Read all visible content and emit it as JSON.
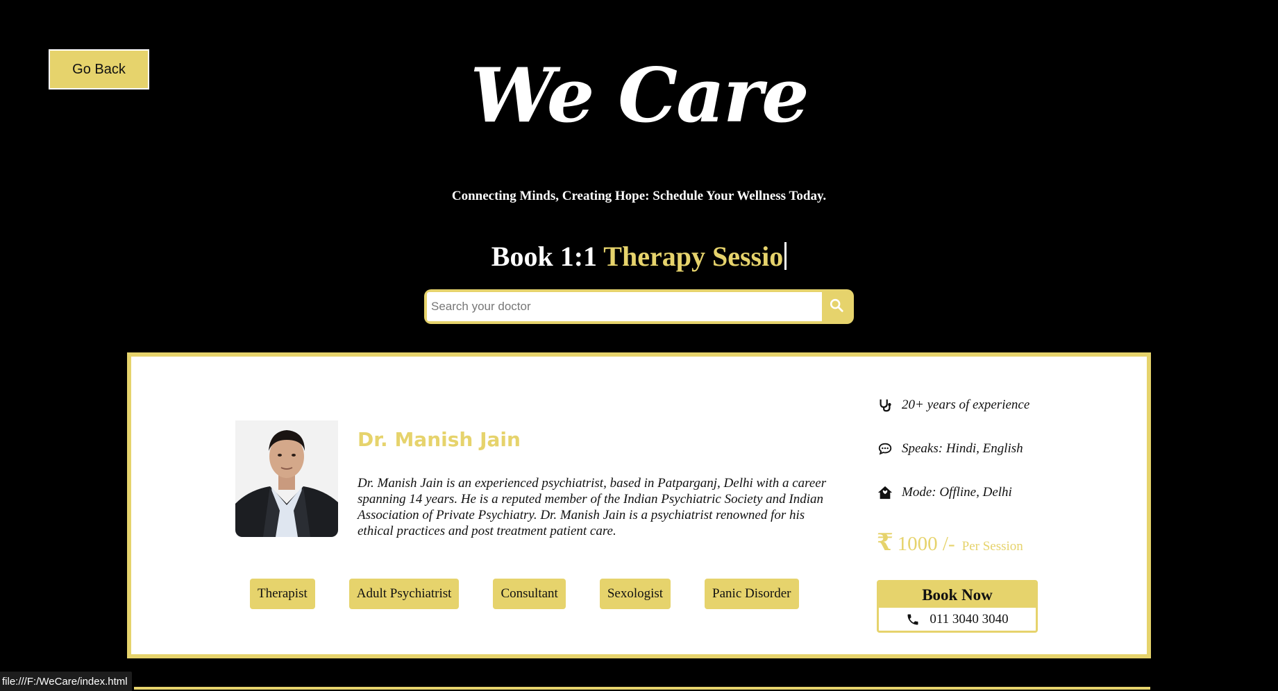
{
  "header": {
    "go_back_label": "Go Back",
    "brand_title": "We Care",
    "tagline": "Connecting Minds, Creating Hope: Schedule Your Wellness Today.",
    "headline_white": "Book 1:1 ",
    "headline_accent": "Therapy Sessio"
  },
  "search": {
    "placeholder": "Search your doctor",
    "icon": "search-icon"
  },
  "doctor": {
    "name": "Dr. Manish Jain",
    "bio": "Dr. Manish Jain is an experienced psychiatrist, based in Patparganj, Delhi with a career spanning 14 years. He is a reputed member of the Indian Psychiatric Society and Indian Association of Private Psychiatry. Dr. Manish Jain is a psychiatrist renowned for his ethical practices and post treatment patient care.",
    "tags": [
      "Therapist",
      "Adult Psychiatrist",
      "Consultant",
      "Sexologist",
      "Panic Disorder"
    ],
    "experience": "20+ years of experience",
    "languages": "Speaks: Hindi, English",
    "mode": "Mode: Offline, Delhi",
    "price_symbol": "₹",
    "price_amount": "1000 /-",
    "price_unit": "Per Session",
    "book_label": "Book Now",
    "phone": "011 3040 3040"
  },
  "statusbar": {
    "url": "file:///F:/WeCare/index.html"
  },
  "colors": {
    "accent": "#e6d36c",
    "background": "#000000",
    "card": "#ffffff"
  }
}
